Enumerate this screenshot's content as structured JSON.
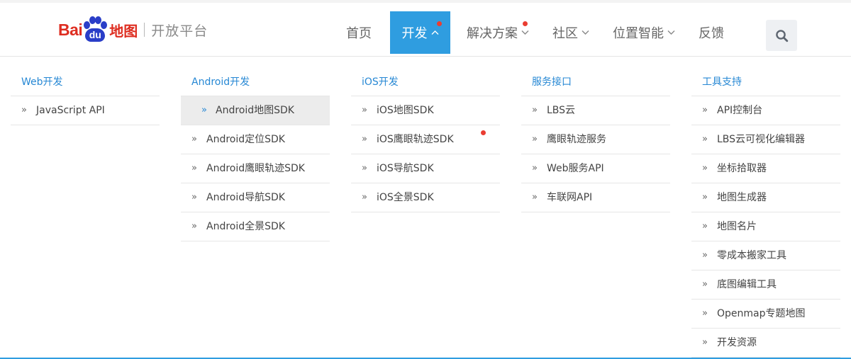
{
  "logo": {
    "bai": "Bai",
    "du": "du",
    "map_cn": "地图",
    "platform": "开放平台"
  },
  "nav": {
    "items": [
      {
        "label": "首页",
        "has_chevron": false,
        "active": false,
        "dot": false
      },
      {
        "label": "开发",
        "has_chevron": true,
        "active": true,
        "dot": true
      },
      {
        "label": "解决方案",
        "has_chevron": true,
        "active": false,
        "dot": true
      },
      {
        "label": "社区",
        "has_chevron": true,
        "active": false,
        "dot": false
      },
      {
        "label": "位置智能",
        "has_chevron": true,
        "active": false,
        "dot": false
      },
      {
        "label": "反馈",
        "has_chevron": false,
        "active": false,
        "dot": false
      }
    ],
    "search_icon": "search-icon"
  },
  "colors": {
    "accent": "#2f9de0",
    "link": "#2788d4",
    "dot": "#ea3d31",
    "logo_red": "#de2d20",
    "logo_blue": "#2a3ec8"
  },
  "menu": {
    "columns": [
      {
        "title": "Web开发",
        "items": [
          "JavaScript API"
        ]
      },
      {
        "title": "Android开发",
        "items": [
          "Android地图SDK",
          "Android定位SDK",
          "Android鹰眼轨迹SDK",
          "Android导航SDK",
          "Android全景SDK"
        ],
        "highlighted_index": 0
      },
      {
        "title": "iOS开发",
        "items": [
          "iOS地图SDK",
          "iOS鹰眼轨迹SDK",
          "iOS导航SDK",
          "iOS全景SDK"
        ],
        "dot_index": 1
      },
      {
        "title": "服务接口",
        "items": [
          "LBS云",
          "鹰眼轨迹服务",
          "Web服务API",
          "车联网API"
        ]
      },
      {
        "title": "工具支持",
        "items": [
          "API控制台",
          "LBS云可视化编辑器",
          "坐标拾取器",
          "地图生成器",
          "地图名片",
          "零成本搬家工具",
          "底图编辑工具",
          "Openmap专题地图",
          "开发资源"
        ]
      }
    ]
  }
}
